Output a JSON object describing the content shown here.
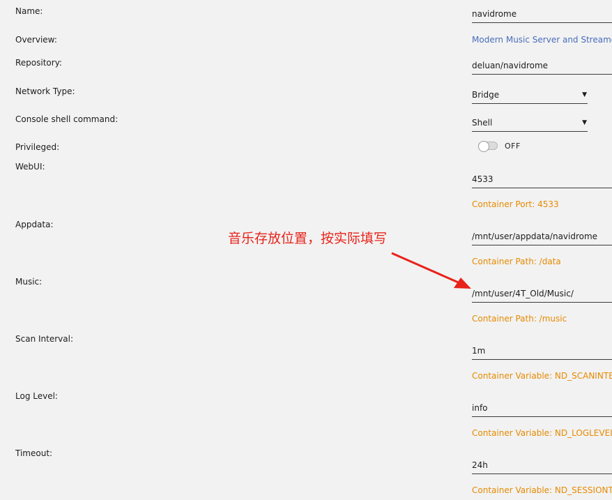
{
  "form": {
    "name": {
      "label": "Name:",
      "value": "navidrome"
    },
    "overview": {
      "label": "Overview:",
      "value": "Modern Music Server and Streamer"
    },
    "repository": {
      "label": "Repository:",
      "value": "deluan/navidrome"
    },
    "network_type": {
      "label": "Network Type:",
      "value": "Bridge"
    },
    "console_shell": {
      "label": "Console shell command:",
      "value": "Shell"
    },
    "privileged": {
      "label": "Privileged:",
      "state": "OFF"
    },
    "webui": {
      "label": "WebUI:",
      "value": "4533",
      "hint": "Container Port: 4533"
    },
    "appdata": {
      "label": "Appdata:",
      "value": "/mnt/user/appdata/navidrome",
      "hint": "Container Path: /data"
    },
    "music": {
      "label": "Music:",
      "value": "/mnt/user/4T_Old/Music/",
      "hint": "Container Path: /music"
    },
    "scan_interval": {
      "label": "Scan Interval:",
      "value": "1m",
      "hint": "Container Variable: ND_SCANINTERVAL"
    },
    "log_level": {
      "label": "Log Level:",
      "value": "info",
      "hint": "Container Variable: ND_LOGLEVEL"
    },
    "timeout": {
      "label": "Timeout:",
      "value": "24h",
      "hint": "Container Variable: ND_SESSIONTIMEOUT"
    }
  },
  "annotation": {
    "text": "音乐存放位置，按实际填写",
    "color": "#e8231a"
  },
  "colors": {
    "hint": "#e68a00",
    "link": "#486dba",
    "background": "#f2f2f2"
  }
}
